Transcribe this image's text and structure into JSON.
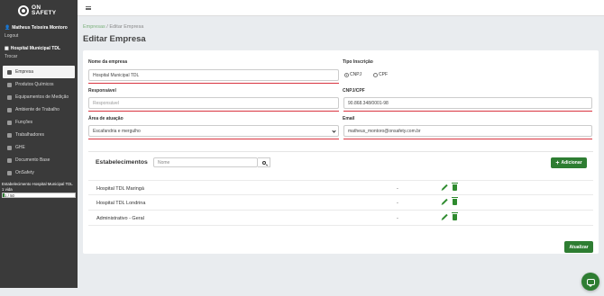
{
  "brand": {
    "line1": "ON",
    "line2": "SAFETY"
  },
  "sidebar": {
    "user_name": "Matheus Teixeira Montoro",
    "logout_label": "Logout",
    "organization": "Hospital Municipal TDL",
    "switch_label": "Trocar",
    "items": [
      {
        "label": "Empresa",
        "icon": "building-icon",
        "active": true
      },
      {
        "label": "Produtos Químicos",
        "icon": "flask-icon"
      },
      {
        "label": "Equipamentos de Medição",
        "icon": "gauge-icon"
      },
      {
        "label": "Ambiente de Trabalho",
        "icon": "workplace-icon"
      },
      {
        "label": "Funções",
        "icon": "users-icon"
      },
      {
        "label": "Trabalhadores",
        "icon": "workers-icon"
      },
      {
        "label": "GHE",
        "icon": "group-icon"
      },
      {
        "label": "Documento Base",
        "icon": "document-icon"
      },
      {
        "label": "OnSafety",
        "icon": "shield-icon"
      }
    ],
    "establishment_title": "Estabelecimento Hospital Municipal TDL",
    "lives_label": "1 vida",
    "lives_usage": "1 / 50",
    "lives_fraction": 0.02
  },
  "breadcrumb": {
    "link": "Empresas",
    "separator": "/",
    "current": "Editar Empresa"
  },
  "page_title": "Editar Empresa",
  "form": {
    "company_name_label": "Nome da empresa",
    "company_name_value": "Hospital Municipal TDL",
    "inscription_type_label": "Tipo Inscrição",
    "inscription_options": [
      "CNPJ",
      "CPF"
    ],
    "inscription_selected": "CNPJ",
    "responsible_label": "Responsável",
    "responsible_placeholder": "Responsável",
    "cnpj_label": "CNPJ/CPF",
    "cnpj_value": "90.868.348/0001-98",
    "area_label": "Área de atuação",
    "area_value": "Escafandria e mergulho",
    "email_label": "Email",
    "email_value": "matheus_montoro@onsafety.com.br"
  },
  "establishments": {
    "title": "Estabelecimentos",
    "search_placeholder": "Nome",
    "add_label": "Adicionar",
    "rows": [
      {
        "name": "Hospital TDL Maringá",
        "value": "-"
      },
      {
        "name": "Hospital TDL Londrina",
        "value": "-"
      },
      {
        "name": "Administrativo - Geral",
        "value": "-"
      }
    ]
  },
  "update_label": "Atualizar",
  "colors": {
    "primary": "#2e7d32",
    "sidebar": "#3a3a3a",
    "error": "#d9333f"
  }
}
